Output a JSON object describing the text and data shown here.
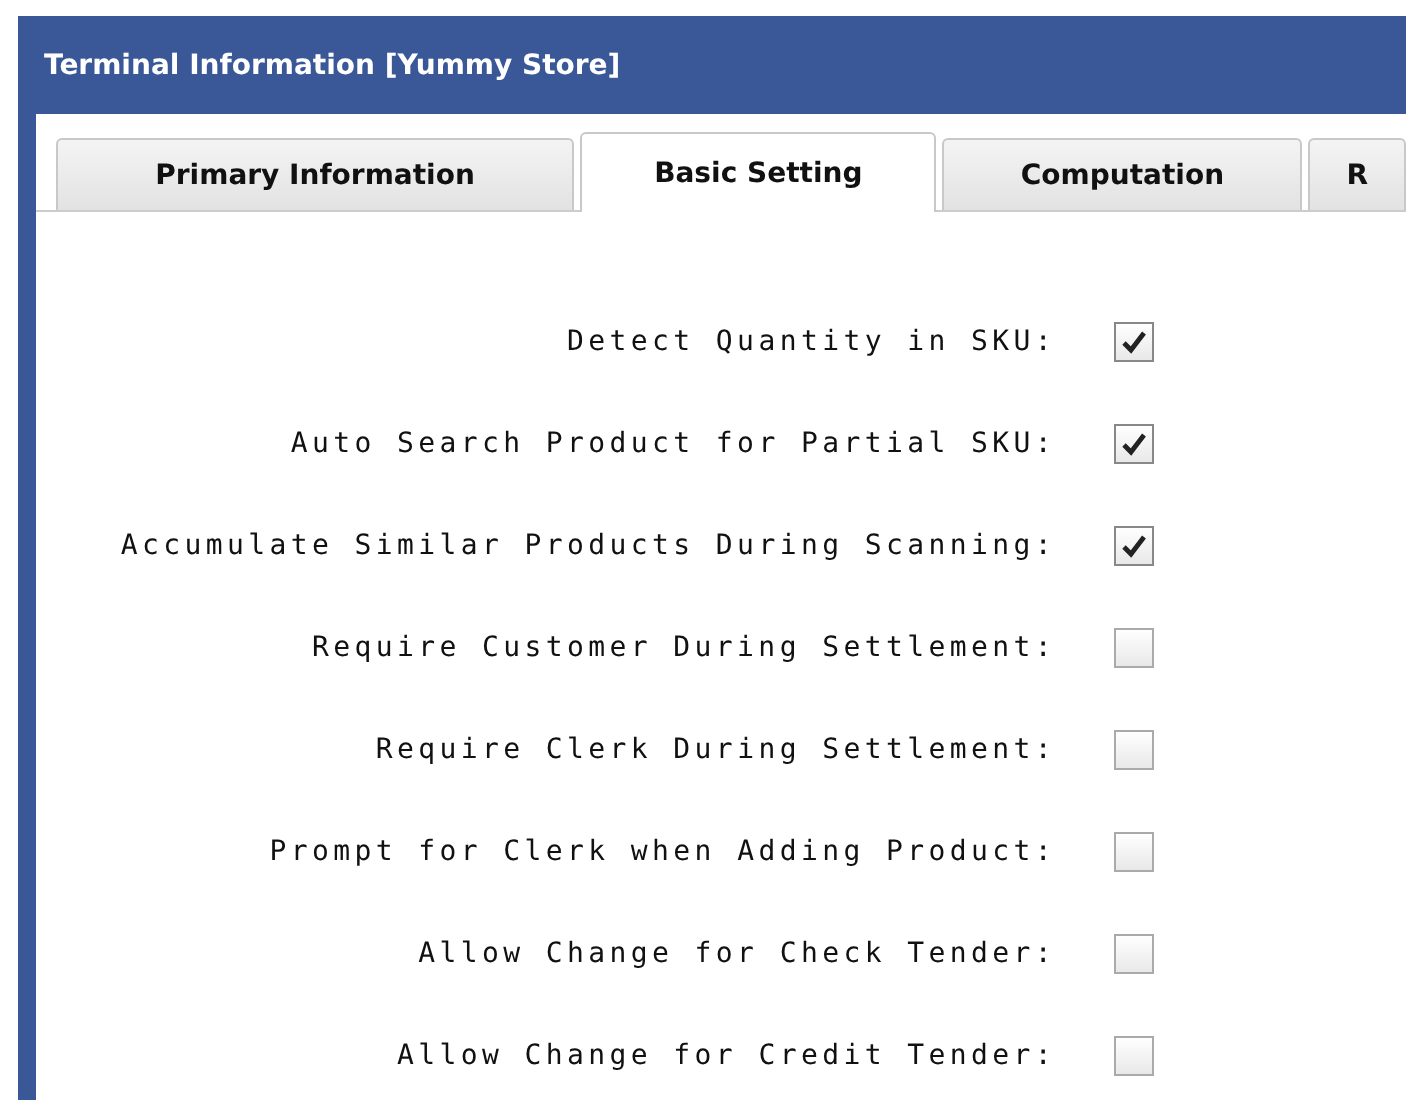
{
  "window": {
    "title": "Terminal Information [Yummy Store]"
  },
  "tabs": [
    {
      "label": "Primary Information",
      "selected": false
    },
    {
      "label": "Basic Setting",
      "selected": true
    },
    {
      "label": "Computation",
      "selected": false
    },
    {
      "label": "R",
      "selected": false
    }
  ],
  "settings": [
    {
      "label": "Detect Quantity in SKU:",
      "checked": true
    },
    {
      "label": "Auto Search Product for Partial SKU:",
      "checked": true
    },
    {
      "label": "Accumulate Similar Products During Scanning:",
      "checked": true
    },
    {
      "label": "Require Customer During Settlement:",
      "checked": false
    },
    {
      "label": "Require Clerk During Settlement:",
      "checked": false
    },
    {
      "label": "Prompt for Clerk when Adding Product:",
      "checked": false
    },
    {
      "label": "Allow Change for Check Tender:",
      "checked": false
    },
    {
      "label": "Allow Change for Credit Tender:",
      "checked": false
    }
  ]
}
